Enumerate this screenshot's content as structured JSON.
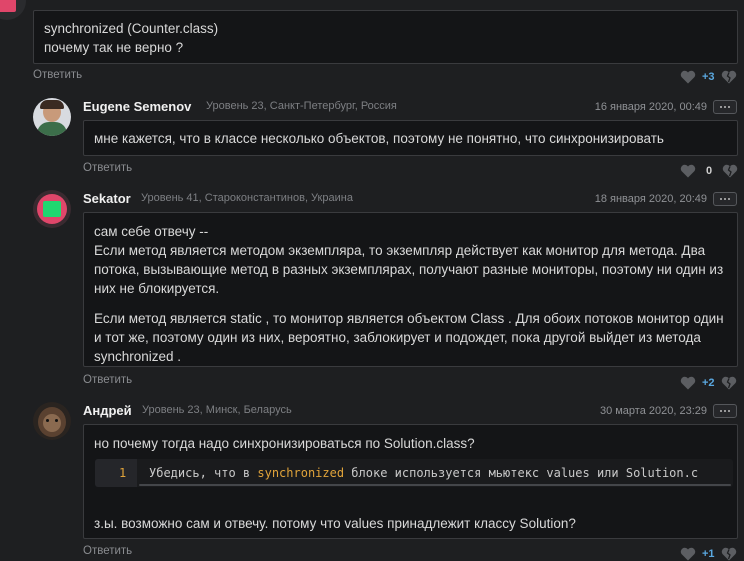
{
  "top_comment": {
    "lines": [
      "synchronized (Counter.class)",
      "почему так не верно ?"
    ],
    "reply_label": "Ответить",
    "votes": "+3"
  },
  "comments": [
    {
      "author": "Eugene Semenov",
      "meta": "Уровень 23, Санкт-Петербург, Россия",
      "date": "16 января 2020, 00:49",
      "paragraphs": [
        "мне кажется, что в классе несколько объектов, поэтому не понятно, что синхронизировать"
      ],
      "reply_label": "Ответить",
      "votes": "0"
    },
    {
      "author": "Sekator",
      "meta": "Уровень 41, Староконстантинов, Украина",
      "date": "18 января 2020, 20:49",
      "paragraphs": [
        "сам себе отвечу --",
        "Если метод является методом экземпляра, то экземпляр действует как монитор для метода. Два потока, вызывающие метод в разных экземплярах, получают разные мониторы, поэтому ни один из них не блокируется.",
        "Если метод является static , то монитор является объектом Class . Для обоих потоков монитор один и тот же, поэтому один из них, вероятно, заблокирует и подождет, пока другой выйдет из метода synchronized ."
      ],
      "reply_label": "Ответить",
      "votes": "+2"
    },
    {
      "author": "Андрей",
      "meta": "Уровень 23, Минск, Беларусь",
      "date": "30 марта 2020, 23:29",
      "question": "но почему тогда надо синхронизироваться по Solution.class?",
      "code": {
        "line_no": "1",
        "before": "Убедись, что в ",
        "keyword": "synchronized",
        "after": " блоке используется мьютекс values или Solution.c"
      },
      "footer": "з.ы. возможно сам и отвечу. потому что values принадлежит классу Solution?",
      "reply_label": "Ответить",
      "votes": "+1"
    }
  ],
  "colors": {
    "background": "#1e1f21",
    "box": "#141517",
    "vote_positive": "#5aa8e0",
    "keyword": "#e0a33a",
    "avatar_green": "#20d870"
  }
}
